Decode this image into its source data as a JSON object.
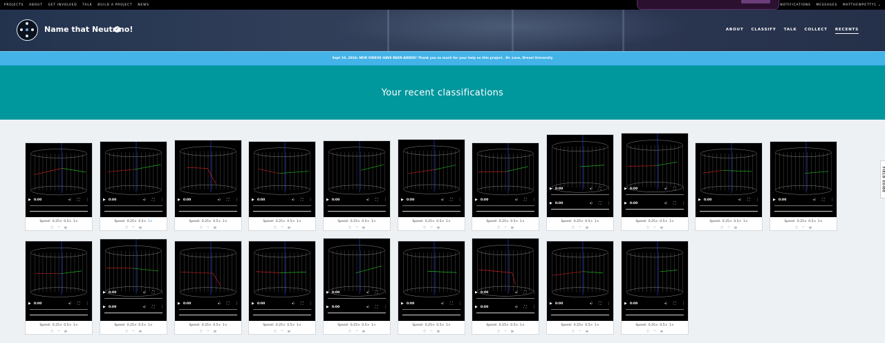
{
  "top_nav": {
    "left": [
      "PROJECTS",
      "ABOUT",
      "GET INVOLVED",
      "TALK",
      "BUILD A PROJECT",
      "NEWS"
    ],
    "right": [
      "NOTIFICATIONS",
      "MESSAGES",
      "MATTHEWPETTY1"
    ],
    "user_menu_icon": "chevron-down-icon"
  },
  "project": {
    "title": "Name that Neutrino!",
    "verified_icon": "check-badge-icon",
    "nav": [
      "ABOUT",
      "CLASSIFY",
      "TALK",
      "COLLECT",
      "RECENTS"
    ],
    "active_nav": "RECENTS"
  },
  "announcement": "Sept 10, 2024: NEW VIDEOS HAVE BEEN ADDED! Thank you so much for your help on this project. -Dr. Love, Drexel University",
  "page": {
    "heading": "Your recent classifications"
  },
  "field_guide": "FIELD GUIDE",
  "video": {
    "time": "0:00",
    "play_icon": "play-icon",
    "volume_icon": "volume-icon",
    "fullscreen_icon": "fullscreen-icon",
    "more_icon": "more-vertical-icon"
  },
  "speed": {
    "label": "Speed:",
    "options": [
      "0.25×",
      "0.5×",
      "1×"
    ],
    "selected": "1×"
  },
  "card_buttons": [
    {
      "icon": "info-icon",
      "glyph": "ⓘ"
    },
    {
      "icon": "heart-icon",
      "glyph": "♡"
    },
    {
      "icon": "collect-icon",
      "glyph": "▤"
    }
  ],
  "colors": {
    "banner": "#00979d",
    "announcement": "#43b3e8",
    "header": "#2f3d58"
  },
  "recents": [
    {
      "row": 1,
      "controls": 1,
      "track": "red-green"
    },
    {
      "row": 1,
      "controls": 1,
      "track": "red-green"
    },
    {
      "row": 1,
      "controls": 1,
      "track": "red"
    },
    {
      "row": 1,
      "controls": 1,
      "track": "red-green"
    },
    {
      "row": 1,
      "controls": 1,
      "track": "green"
    },
    {
      "row": 1,
      "controls": 1,
      "track": "red-green"
    },
    {
      "row": 1,
      "controls": 1,
      "track": "red-green"
    },
    {
      "row": 1,
      "controls": 2,
      "track": "green"
    },
    {
      "row": 1,
      "controls": 2,
      "track": "red-green"
    },
    {
      "row": 1,
      "controls": 1,
      "track": "red-green"
    },
    {
      "row": 1,
      "controls": 1,
      "track": "green"
    },
    {
      "row": 2,
      "controls": 1,
      "track": "green-red"
    },
    {
      "row": 2,
      "controls": 2,
      "track": "red-green"
    },
    {
      "row": 2,
      "controls": 1,
      "track": "red"
    },
    {
      "row": 2,
      "controls": 1,
      "track": "red-green"
    },
    {
      "row": 2,
      "controls": 2,
      "track": "green"
    },
    {
      "row": 2,
      "controls": 1,
      "track": "green"
    },
    {
      "row": 2,
      "controls": 2,
      "track": "red"
    },
    {
      "row": 2,
      "controls": 1,
      "track": "red-green"
    },
    {
      "row": 2,
      "controls": 1,
      "track": "green"
    }
  ]
}
